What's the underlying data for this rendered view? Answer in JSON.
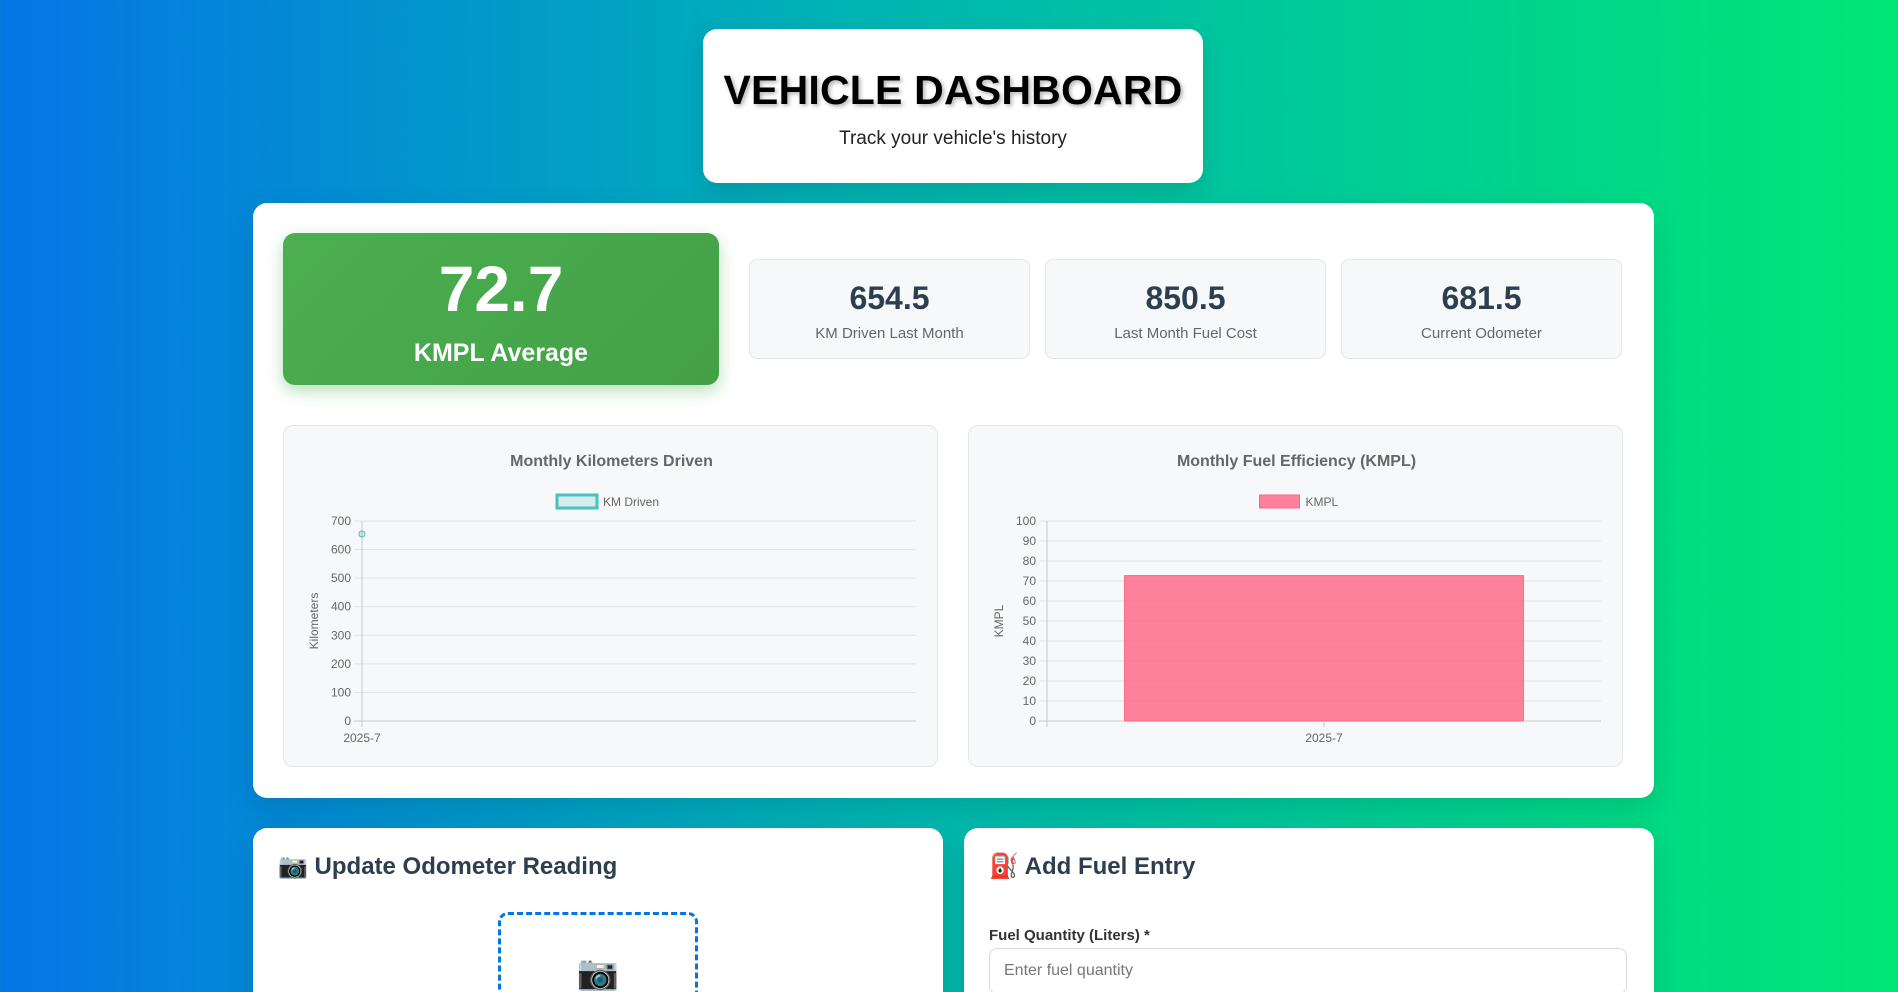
{
  "header": {
    "title": "VEHICLE DASHBOARD",
    "subtitle": "Track your vehicle's history"
  },
  "summary": {
    "average": {
      "value": "72.7",
      "label": "KMPL Average"
    },
    "stats": [
      {
        "value": "654.5",
        "label": "KM Driven Last Month"
      },
      {
        "value": "850.5",
        "label": "Last Month Fuel Cost"
      },
      {
        "value": "681.5",
        "label": "Current Odometer"
      }
    ]
  },
  "chart_data": [
    {
      "type": "line",
      "title": "Monthly Kilometers Driven",
      "legend": [
        "KM Driven"
      ],
      "legend_position": "top",
      "categories": [
        "2025-7"
      ],
      "series": [
        {
          "name": "KM Driven",
          "values": [
            654.5
          ]
        }
      ],
      "xlabel": "",
      "ylabel": "Kilometers",
      "ylim": [
        0,
        700
      ],
      "yticks": [
        0,
        100,
        200,
        300,
        400,
        500,
        600,
        700
      ],
      "grid": true,
      "color": "#4bc0c0"
    },
    {
      "type": "bar",
      "title": "Monthly Fuel Efficiency (KMPL)",
      "legend": [
        "KMPL"
      ],
      "legend_position": "top",
      "categories": [
        "2025-7"
      ],
      "series": [
        {
          "name": "KMPL",
          "values": [
            72.7
          ]
        }
      ],
      "xlabel": "",
      "ylabel": "KMPL",
      "ylim": [
        0,
        100
      ],
      "yticks": [
        0,
        10,
        20,
        30,
        40,
        50,
        60,
        70,
        80,
        90,
        100
      ],
      "grid": true,
      "color": "#ff6384"
    }
  ],
  "odometer_section": {
    "title": "📷 Update Odometer Reading",
    "upload_icon": "📷",
    "icon_name": "camera-icon"
  },
  "fuel_section": {
    "title": "⛽ Add Fuel Entry",
    "quantity_label": "Fuel Quantity (Liters) *",
    "quantity_placeholder": "Enter fuel quantity",
    "quantity_value": ""
  }
}
